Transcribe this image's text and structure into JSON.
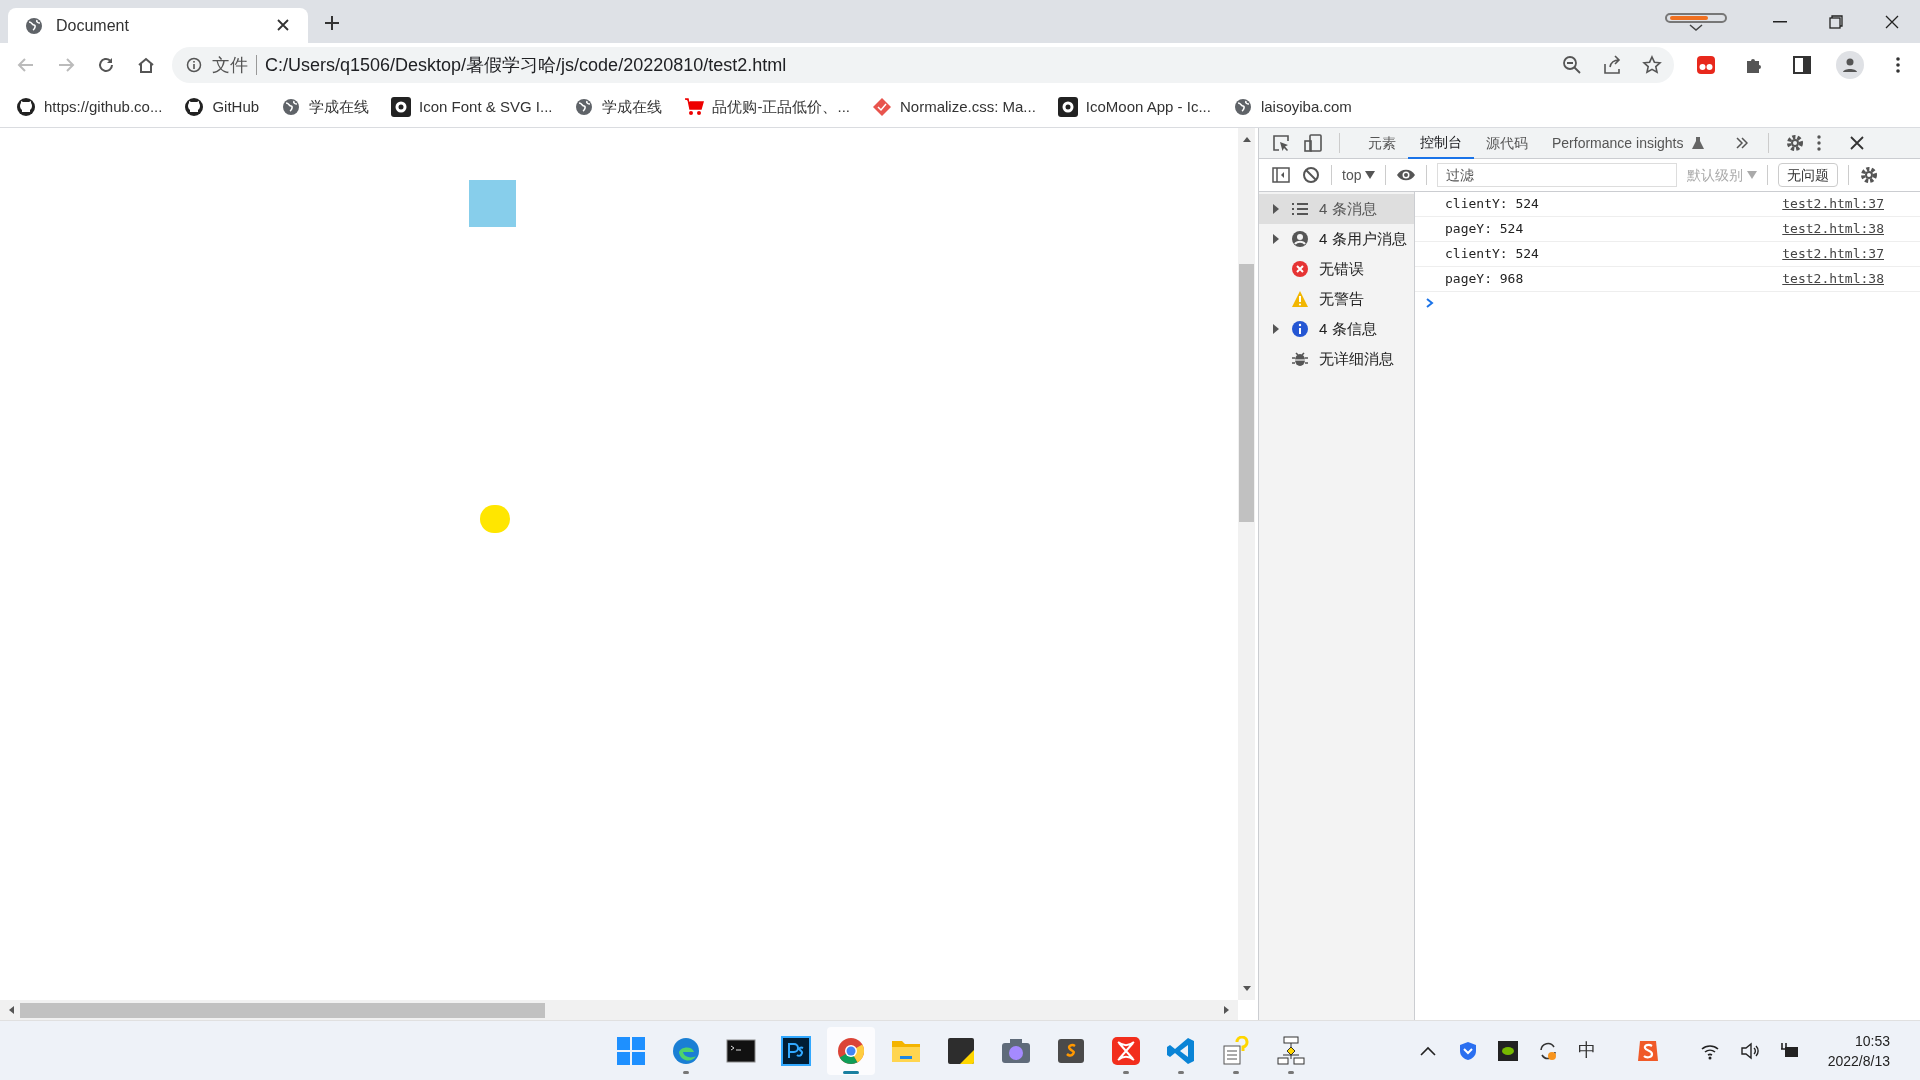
{
  "browser_tab": {
    "title": "Document",
    "selected": true
  },
  "address_bar": {
    "scheme_label": "文件",
    "url": "C:/Users/q1506/Desktop/暑假学习哈/js/code/20220810/test2.html"
  },
  "bookmarks": [
    {
      "label": "https://github.co...",
      "kind": "github"
    },
    {
      "label": "GitHub",
      "kind": "github"
    },
    {
      "label": "学成在线",
      "kind": "globe"
    },
    {
      "label": "Icon Font & SVG I...",
      "kind": "eye"
    },
    {
      "label": "学成在线",
      "kind": "globe"
    },
    {
      "label": "品优购-正品低价、...",
      "kind": "cart"
    },
    {
      "label": "Normalize.css: Ma...",
      "kind": "diamond"
    },
    {
      "label": "IcoMoon App - Ic...",
      "kind": "eye"
    },
    {
      "label": "laisoyiba.com",
      "kind": "globe"
    }
  ],
  "devtools": {
    "tabs": [
      {
        "label": "元素",
        "selected": false
      },
      {
        "label": "控制台",
        "selected": true
      },
      {
        "label": "源代码",
        "selected": false
      },
      {
        "label": "Performance insights",
        "selected": false
      }
    ],
    "context": "top",
    "filter_placeholder": "过滤",
    "level_label": "默认级别",
    "issues_label": "无问题",
    "sidebar": [
      {
        "label": "4 条消息",
        "kind": "list",
        "expandable": true,
        "selected": true
      },
      {
        "label": "4 条用户消息",
        "kind": "user",
        "expandable": true,
        "selected": false
      },
      {
        "label": "无错误",
        "kind": "error",
        "expandable": false,
        "selected": false
      },
      {
        "label": "无警告",
        "kind": "warning",
        "expandable": false,
        "selected": false
      },
      {
        "label": "4 条信息",
        "kind": "info",
        "expandable": true,
        "selected": false
      },
      {
        "label": "无详细消息",
        "kind": "verbose",
        "expandable": false,
        "selected": false
      }
    ],
    "messages": [
      {
        "text": "clientY: 524",
        "source": "test2.html:37"
      },
      {
        "text": "pageY: 524",
        "source": "test2.html:38"
      },
      {
        "text": "clientY: 524",
        "source": "test2.html:37"
      },
      {
        "text": "pageY: 968",
        "source": "test2.html:38"
      }
    ]
  },
  "taskbar": {
    "apps": [
      {
        "kind": "start",
        "running": false,
        "active": false
      },
      {
        "kind": "edge",
        "running": true,
        "active": false
      },
      {
        "kind": "terminal",
        "running": false,
        "active": false
      },
      {
        "kind": "ps",
        "running": false,
        "active": false
      },
      {
        "kind": "chrome",
        "running": true,
        "active": true
      },
      {
        "kind": "folder",
        "running": false,
        "active": false
      },
      {
        "kind": "notes",
        "running": false,
        "active": false
      },
      {
        "kind": "camera",
        "running": false,
        "active": false
      },
      {
        "kind": "sublime",
        "running": false,
        "active": false
      },
      {
        "kind": "xmind",
        "running": true,
        "active": false
      },
      {
        "kind": "vscode",
        "running": true,
        "active": false
      },
      {
        "kind": "help",
        "running": true,
        "active": false
      },
      {
        "kind": "flow",
        "running": true,
        "active": false
      }
    ],
    "ime": "中",
    "time": "10:53",
    "date": "2022/8/13"
  }
}
